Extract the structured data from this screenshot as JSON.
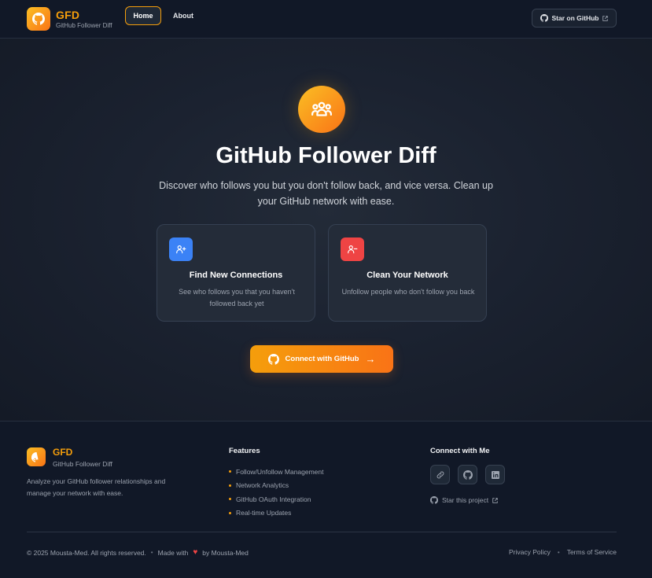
{
  "brand": {
    "name": "GFD",
    "tagline": "GitHub Follower Diff",
    "accent": "#f59e0b"
  },
  "nav": {
    "items": [
      {
        "label": "Home",
        "active": true
      },
      {
        "label": "About",
        "active": false
      }
    ],
    "star_button": "Star on GitHub"
  },
  "hero": {
    "icon": "users-group-icon",
    "title": "GitHub Follower Diff",
    "description": "Discover who follows you but you don't follow back, and vice versa. Clean up your GitHub network with ease.",
    "cards": [
      {
        "icon": "user-plus-icon",
        "title": "Find New Connections",
        "description": "See who follows you that you haven't followed back yet",
        "color": "#3b82f6"
      },
      {
        "icon": "user-minus-icon",
        "title": "Clean Your Network",
        "description": "Unfollow people who don't follow you back",
        "color": "#ef4444"
      }
    ],
    "cta": {
      "label": "Connect with GitHub",
      "icon": "github-icon",
      "arrow": "→"
    }
  },
  "footer": {
    "brand": {
      "name": "GFD",
      "tagline": "GitHub Follower Diff"
    },
    "about": "Analyze your GitHub follower relationships and manage your network with ease.",
    "features": {
      "heading": "Features",
      "items": [
        "Follow/Unfollow Management",
        "Network Analytics",
        "GitHub OAuth Integration",
        "Real-time Updates"
      ]
    },
    "connect": {
      "heading": "Connect with Me",
      "socials": [
        "link-icon",
        "github-icon",
        "linkedin-icon"
      ],
      "star": "Star this project"
    },
    "copyright": "© 2025 Mousta-Med. All rights reserved.",
    "made_with": "Made with",
    "by": "by Mousta-Med",
    "links": [
      "Privacy Policy",
      "Terms of Service"
    ]
  }
}
